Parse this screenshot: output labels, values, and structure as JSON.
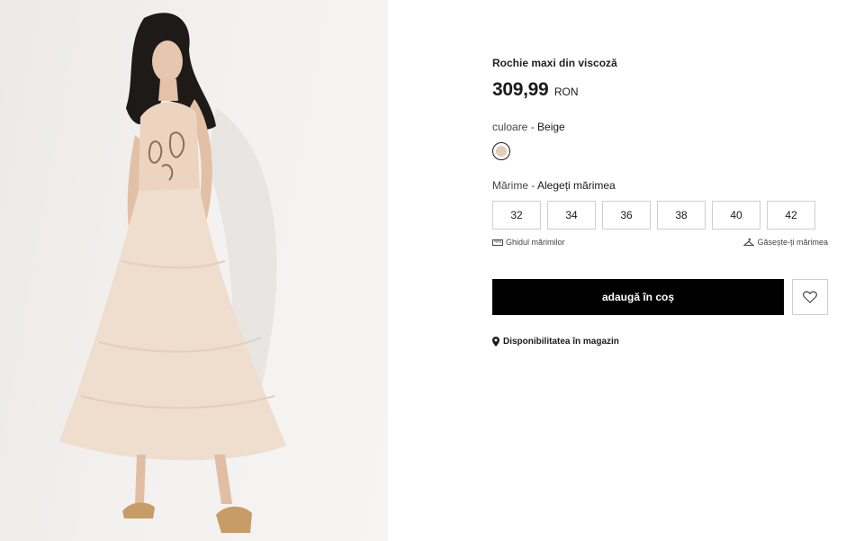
{
  "product": {
    "title": "Rochie maxi din viscoză",
    "price_amount": "309,99",
    "price_currency": "RON",
    "image_icon": "product-photo"
  },
  "color": {
    "label": "culoare - ",
    "selected": "Beige",
    "swatch_color": "#e2cdb8"
  },
  "size": {
    "label": "Mărime - ",
    "selected": "Alegeți mărimea",
    "options": [
      "32",
      "34",
      "36",
      "38",
      "40",
      "42"
    ],
    "guide_label": "Ghidul mărimilor",
    "guide_icon": "ruler-icon",
    "find_label": "Găsește-ți mărimea",
    "find_icon": "hanger-icon"
  },
  "actions": {
    "add_to_cart": "adaugă în coș",
    "wishlist_icon": "heart-icon",
    "store_availability": "Disponibilitatea în magazin",
    "store_icon": "location-pin-icon"
  }
}
